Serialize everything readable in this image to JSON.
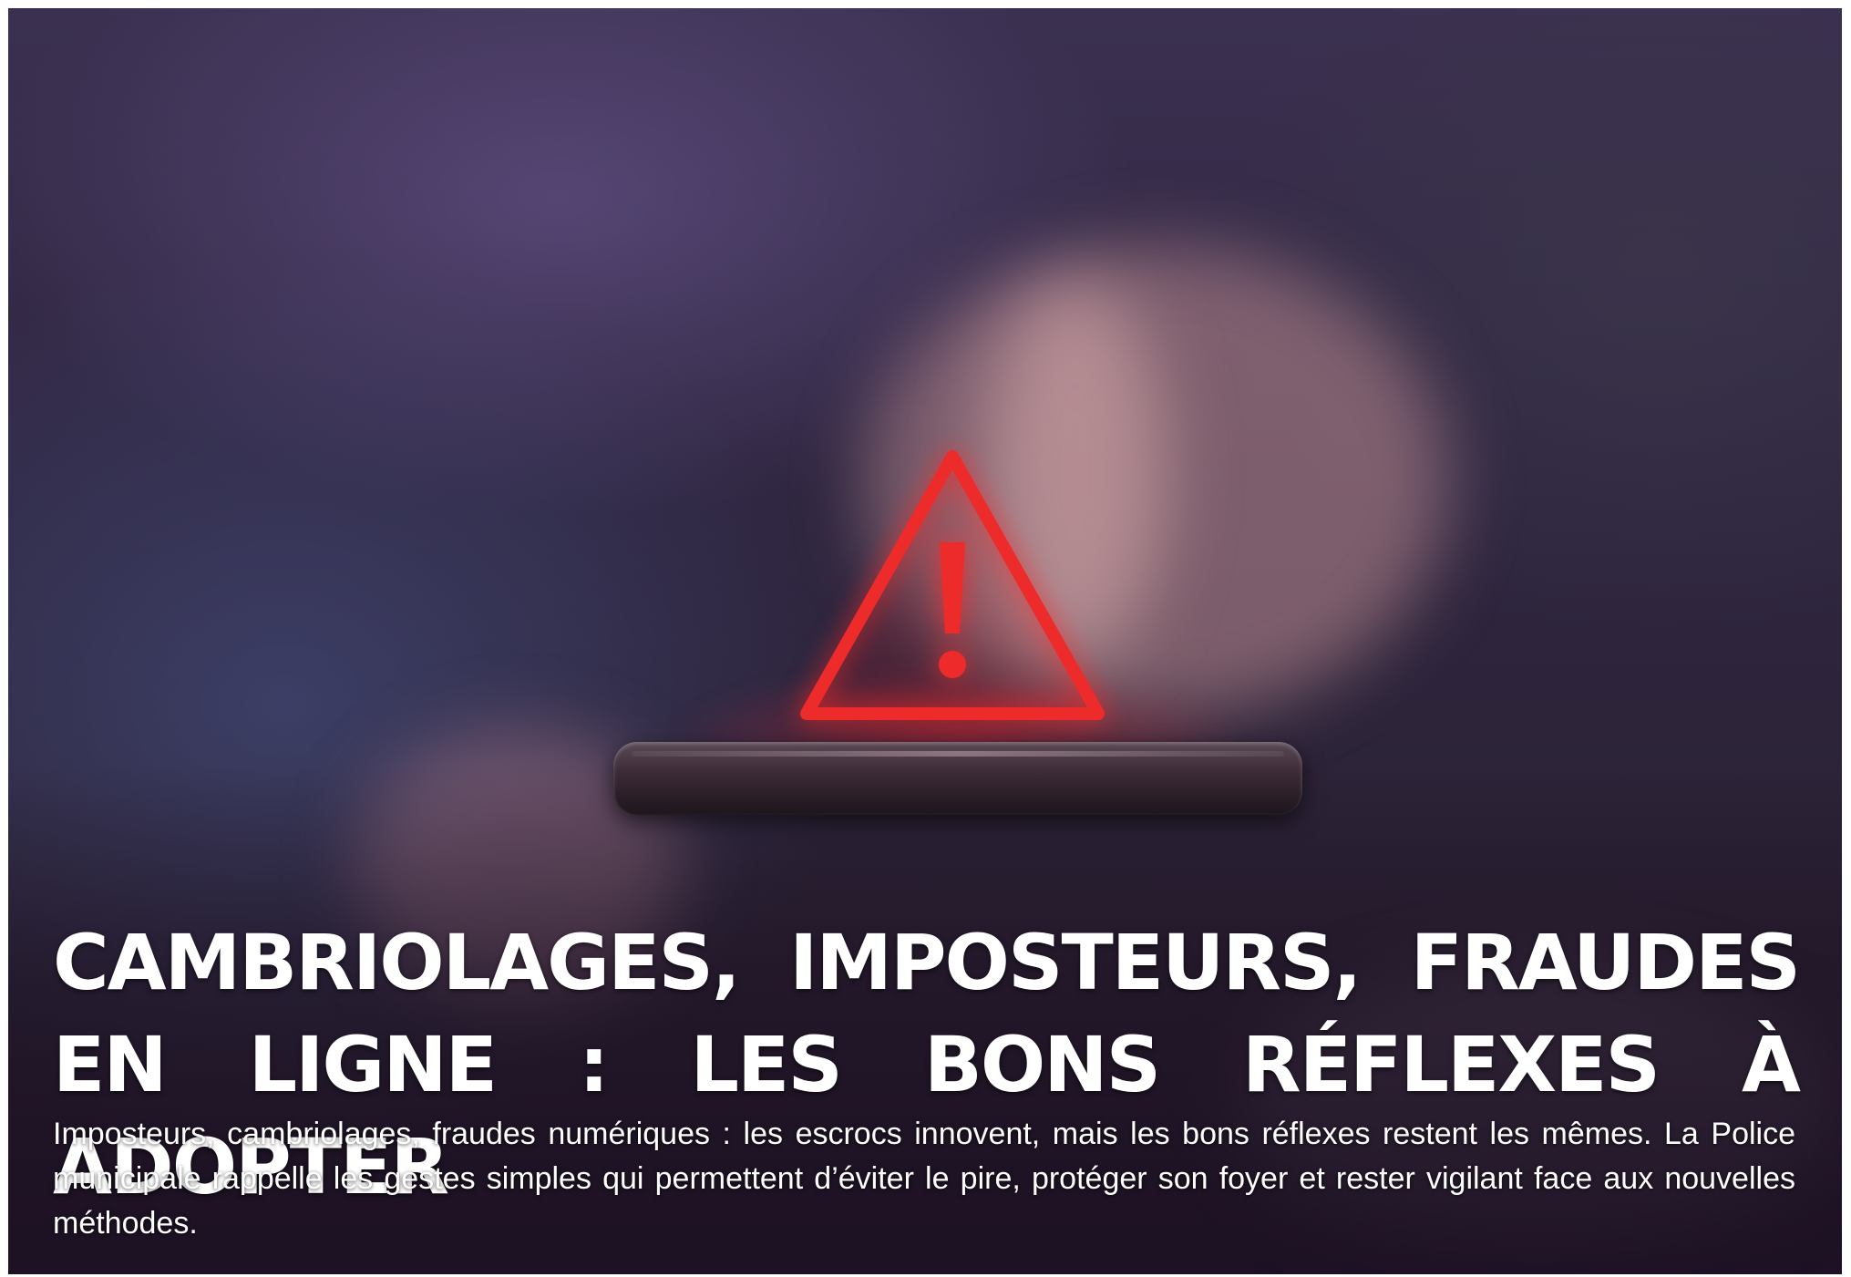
{
  "headline": {
    "line1": "CAMBRIOLAGES, IMPOSTEURS, FRAUDES",
    "line2": "EN LIGNE : LES BONS RÉFLEXES À ADOPTER"
  },
  "lead": "Imposteurs, cambriolages, fraudes numériques : les escrocs innovent, mais les bons réflexes restent les mêmes. La Police municipale rappelle les gestes simples qui permettent d’éviter le pire, protéger son foyer et rester vigilant face aux nouvelles méthodes.",
  "icons": {
    "warning": "warning-triangle-icon"
  },
  "colors": {
    "warning_red": "#ee2b2b",
    "text": "#ffffff",
    "background": "#2b2235"
  }
}
